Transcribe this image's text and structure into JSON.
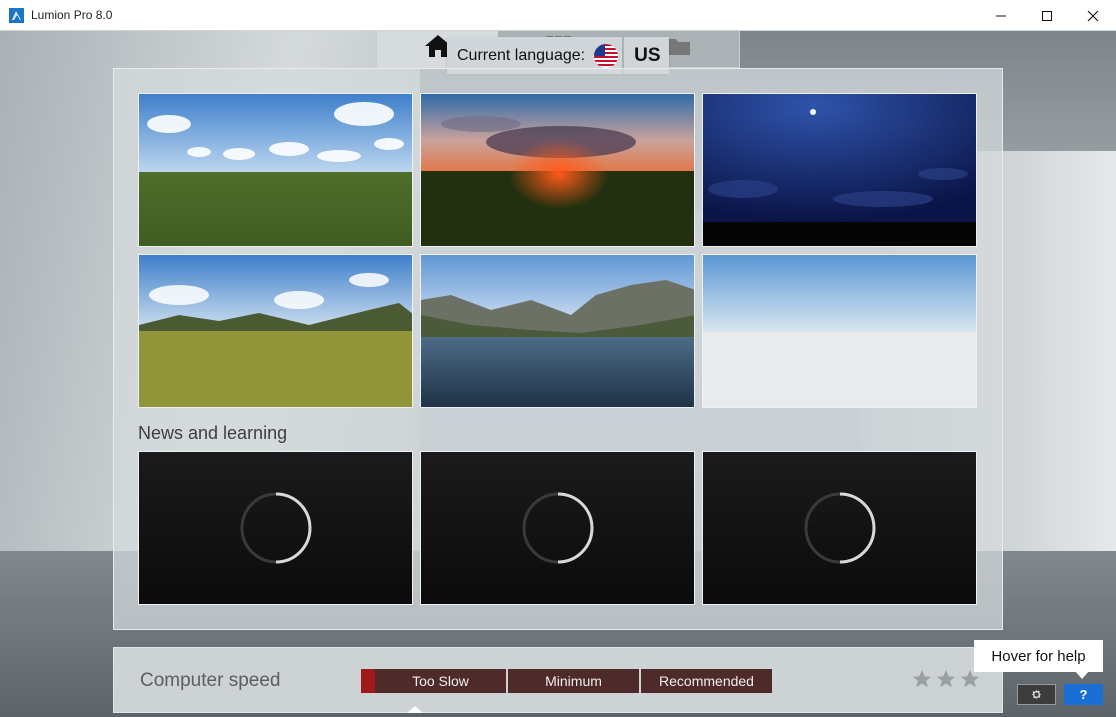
{
  "window": {
    "title": "Lumion Pro 8.0",
    "controls": [
      "minimize-icon",
      "maximize-icon",
      "close-icon"
    ]
  },
  "top_tabs": [
    {
      "name": "home",
      "icon": "home-icon",
      "active": true
    },
    {
      "name": "examples",
      "icon": "grid-icon",
      "active": false
    },
    {
      "name": "load-scene",
      "icon": "folder-icon",
      "active": false
    }
  ],
  "language": {
    "label": "Current language:",
    "code": "US",
    "flag_icon": "us-flag-icon"
  },
  "scenes": [
    {
      "name": "grass-daylight-clouds"
    },
    {
      "name": "sunset-plain"
    },
    {
      "name": "night-moon"
    },
    {
      "name": "grassland-hills"
    },
    {
      "name": "water-mountains"
    },
    {
      "name": "blank-white-horizon"
    }
  ],
  "news": {
    "title": "News and learning",
    "items": [
      {
        "state": "loading"
      },
      {
        "state": "loading"
      },
      {
        "state": "loading"
      }
    ]
  },
  "speed": {
    "label": "Computer speed",
    "levels": [
      "Too Slow",
      "Minimum",
      "Recommended"
    ],
    "current_level": "Too Slow",
    "indicator_color": "#a01a1a",
    "stars_filled": 0,
    "stars_total": 3
  },
  "help": {
    "tooltip": "Hover for help",
    "help_button": "?",
    "settings_icon": "gear-icon"
  },
  "colors": {
    "accent_blue": "#1a6fd6",
    "speed_button_bg": "#4e2a2a"
  }
}
